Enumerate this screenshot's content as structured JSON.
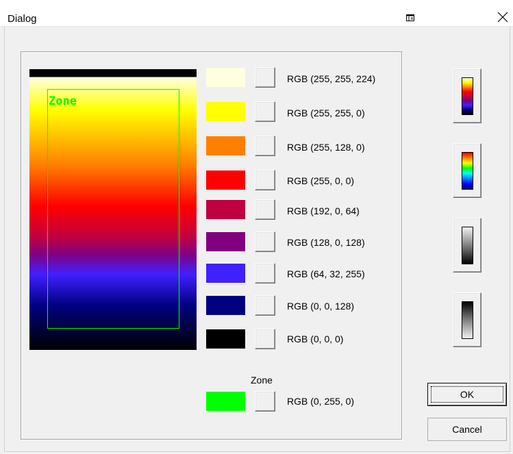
{
  "window": {
    "title": "Dialog"
  },
  "preview": {
    "zone_label": "Zone"
  },
  "colors": [
    {
      "hex": "#ffffe0",
      "label": "RGB (255, 255, 224)"
    },
    {
      "hex": "#ffff00",
      "label": "RGB (255, 255, 0)"
    },
    {
      "hex": "#ff8000",
      "label": "RGB (255, 128, 0)"
    },
    {
      "hex": "#ff0000",
      "label": "RGB (255, 0, 0)"
    },
    {
      "hex": "#c00040",
      "label": "RGB (192, 0, 64)"
    },
    {
      "hex": "#800080",
      "label": "RGB (128, 0, 128)"
    },
    {
      "hex": "#4020ff",
      "label": "RGB (64, 32, 255)"
    },
    {
      "hex": "#000080",
      "label": "RGB (0, 0, 128)"
    },
    {
      "hex": "#000000",
      "label": "RGB (0, 0, 0)"
    }
  ],
  "zone": {
    "caption": "Zone",
    "hex": "#00ff00",
    "label": "RGB (0, 255, 0)"
  },
  "presets": [
    "hot-palette",
    "rainbow-palette",
    "grayscale-palette",
    "inverted-grayscale-palette"
  ],
  "buttons": {
    "ok": "OK",
    "cancel": "Cancel"
  }
}
